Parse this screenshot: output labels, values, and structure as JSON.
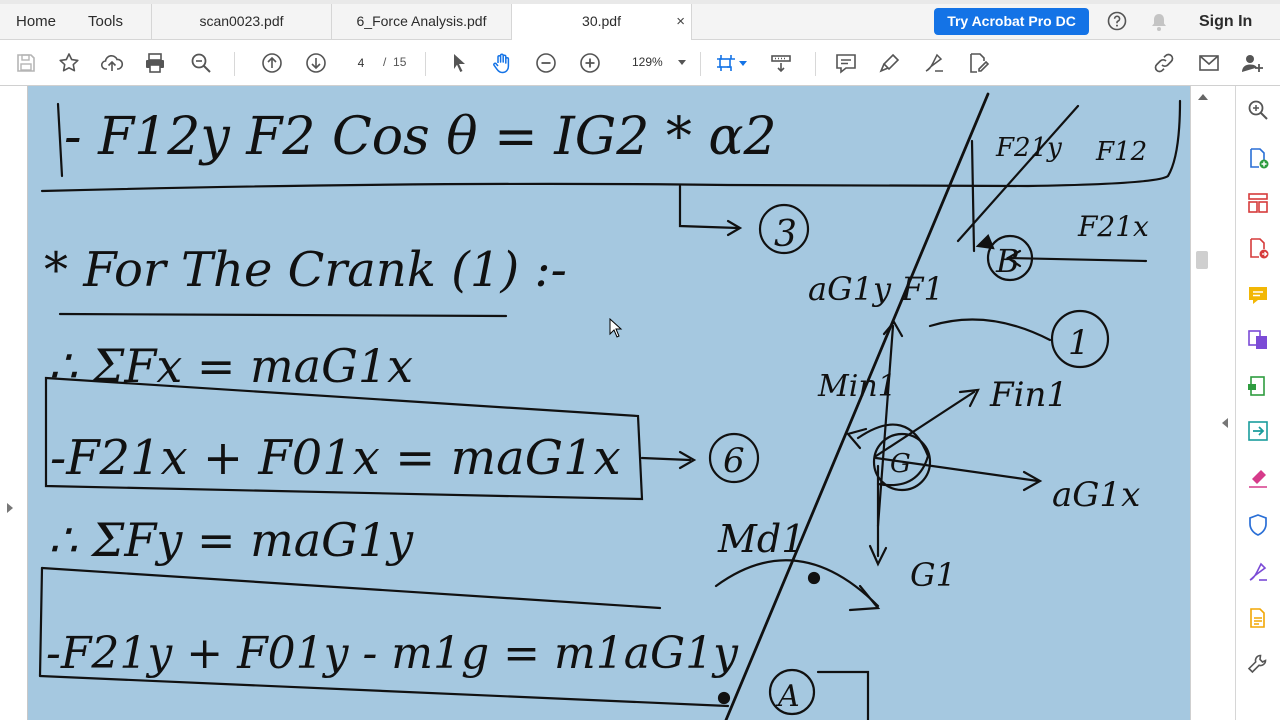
{
  "nav": {
    "home": "Home",
    "tools": "Tools"
  },
  "tabs": [
    {
      "label": "scan0023.pdf",
      "active": false
    },
    {
      "label": "6_Force Analysis.pdf",
      "active": false
    },
    {
      "label": "30.pdf",
      "active": true,
      "close": "×"
    }
  ],
  "header": {
    "try_button": "Try Acrobat Pro DC",
    "sign_in": "Sign In"
  },
  "toolbar": {
    "page_current": "4",
    "page_separator": "/",
    "page_total": "15",
    "zoom": "129%",
    "icons": [
      "save-icon",
      "bookmark-star-icon",
      "upload-cloud-icon",
      "print-icon",
      "zoom-search-icon",
      "page-up-icon",
      "page-down-icon",
      "select-arrow-icon",
      "hand-tool-icon",
      "zoom-out-icon",
      "zoom-in-icon",
      "fit-page-icon",
      "scroll-mode-icon",
      "comment-icon",
      "highlight-pen-icon",
      "sign-icon",
      "edit-pdf-icon",
      "link-icon",
      "email-icon",
      "add-user-icon"
    ]
  },
  "right_panel": {
    "icons": [
      "search-zoom-icon",
      "create-pdf-icon",
      "organize-pages-icon",
      "export-pdf-icon",
      "comment-note-icon",
      "combine-files-icon",
      "edit-pdf-icon",
      "export-convert-icon",
      "fill-sign-icon",
      "protect-shield-icon",
      "send-sign-icon",
      "scan-icon",
      "more-tools-icon"
    ]
  },
  "document": {
    "line1": "- F12y F2 Cos θ = IG2 * α2",
    "eq3": "3",
    "crank_heading": "* For The Crank (1) :-",
    "sum_fx": "∴ ΣFx = maG1x",
    "eq_x": "-F21x + F01x = maG1x",
    "eq6": "6",
    "sum_fy": "∴ ΣFy = maG1y",
    "eq_y": "-F21y + F01y - m1g = m1aG1y",
    "diagram": {
      "f1y": "F21y",
      "f1p": "F12",
      "f1x": "F21x",
      "point_b": "B",
      "agy": "aG1y F1",
      "link": "1",
      "m_in": "Min1",
      "f_in": "Fin1",
      "g_label": "G",
      "agx": "aG1x",
      "md": "Md1",
      "g1": "G1",
      "point_a": "A"
    }
  },
  "colors": {
    "accent": "#1473e6",
    "page_bg": "#a5c8e0",
    "ink": "#111111",
    "tool_blue": "#2a6fd6",
    "tool_red": "#d63b3b",
    "tool_green": "#2e9c3f",
    "tool_purple": "#7b4bd6"
  }
}
